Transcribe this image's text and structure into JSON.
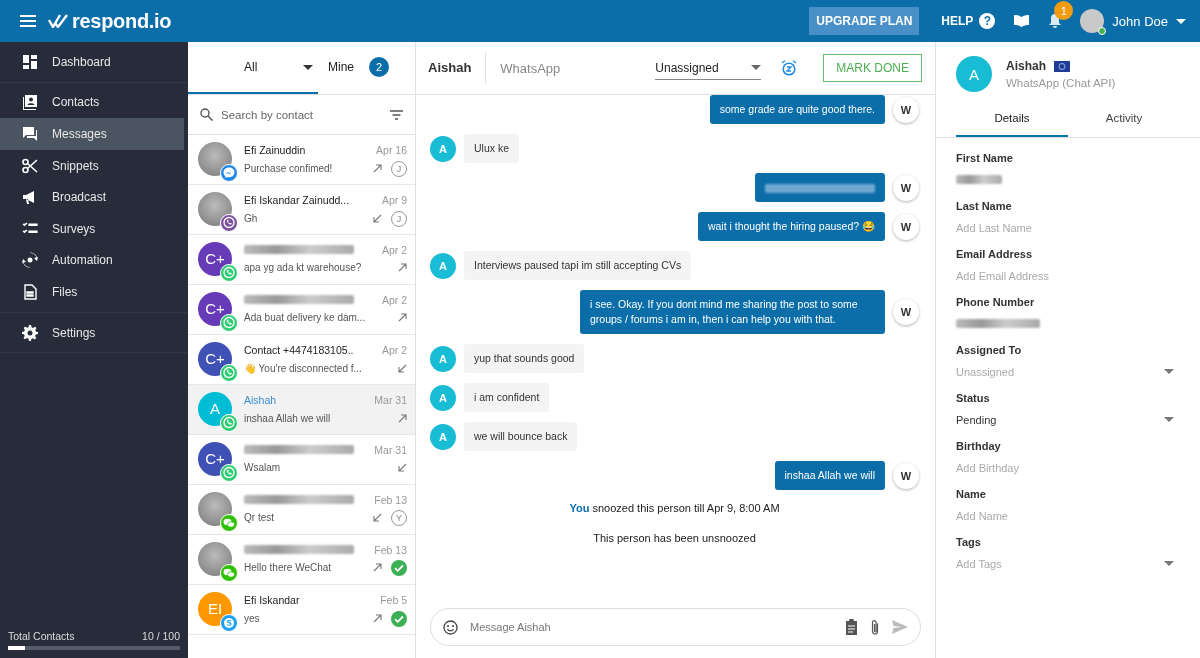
{
  "topbar": {
    "brand": "respond.io",
    "upgrade": "UPGRADE PLAN",
    "help": "HELP",
    "help_mark": "?",
    "notifications": "1",
    "user": "John Doe"
  },
  "sidebar": {
    "groups": [
      [
        {
          "label": "Dashboard",
          "selected": false
        }
      ],
      [
        {
          "label": "Contacts",
          "selected": false
        },
        {
          "label": "Messages",
          "selected": true
        },
        {
          "label": "Snippets",
          "selected": false
        },
        {
          "label": "Broadcast",
          "selected": false
        },
        {
          "label": "Surveys",
          "selected": false
        },
        {
          "label": "Automation",
          "selected": false
        },
        {
          "label": "Files",
          "selected": false
        }
      ],
      [
        {
          "label": "Settings",
          "selected": false
        }
      ]
    ],
    "footer": {
      "label": "Total Contacts",
      "count": "10 / 100",
      "level": 0.1
    }
  },
  "inbox": {
    "tabs": [
      {
        "label": "All",
        "selected": true,
        "dropdown": true
      },
      {
        "label": "Mine",
        "selected": false,
        "count": "2"
      }
    ],
    "search": {
      "placeholder": "Search by contact"
    },
    "conversations": [
      {
        "kind": "messenger",
        "name": "Efi Zainuddin",
        "preview": "Purchase confimed!",
        "date": "Apr 16",
        "outgoing": true,
        "assignee": "J",
        "done": false,
        "avatar": {
          "kind": "photo"
        },
        "selected": false
      },
      {
        "kind": "viber",
        "name": "Efi Iskandar Zainudd...",
        "preview": "Gh",
        "date": "Apr 9",
        "outgoing": false,
        "assignee": "J",
        "done": false,
        "avatar": {
          "kind": "photo"
        },
        "selected": false
      },
      {
        "kind": "whatsapp",
        "redacted": true,
        "preview": "apa yg ada kt warehouse?",
        "date": "Apr 2",
        "outgoing": true,
        "done": false,
        "avatar": {
          "kind": "initials",
          "text": "C+",
          "color": "#673ab7"
        },
        "selected": false
      },
      {
        "kind": "whatsapp",
        "redacted": true,
        "preview": "Ada buat delivery ke dam...",
        "date": "Apr 2",
        "outgoing": true,
        "done": false,
        "avatar": {
          "kind": "initials",
          "text": "C+",
          "color": "#673ab7"
        },
        "selected": false
      },
      {
        "kind": "whatsapp",
        "name": "Contact +4474183105..",
        "preview": "👋 You're disconnected f...",
        "date": "Apr 2",
        "outgoing": false,
        "done": false,
        "avatar": {
          "kind": "initials",
          "text": "C+",
          "color": "#3f51b5"
        },
        "selected": false
      },
      {
        "kind": "whatsapp",
        "name": "Aishah",
        "preview": "inshaa Allah we will",
        "date": "Mar 31",
        "outgoing": true,
        "done": false,
        "avatar": {
          "kind": "initials",
          "text": "A",
          "color": "#00bcd4"
        },
        "selected": true
      },
      {
        "kind": "whatsapp",
        "redacted": true,
        "preview": "Wsalam",
        "date": "Mar 31",
        "outgoing": false,
        "done": false,
        "avatar": {
          "kind": "initials",
          "text": "C+",
          "color": "#3f51b5"
        },
        "selected": false
      },
      {
        "kind": "wechat",
        "redacted": true,
        "preview": "Qr test",
        "date": "Feb 13",
        "outgoing": false,
        "assignee": "Y",
        "done": false,
        "avatar": {
          "kind": "photo"
        },
        "selected": false
      },
      {
        "kind": "wechat",
        "redacted": true,
        "preview": "Hello there WeChat",
        "date": "Feb 13",
        "outgoing": true,
        "done": true,
        "avatar": {
          "kind": "photo"
        },
        "selected": false
      },
      {
        "kind": "skype",
        "name": "Efi Iskandar",
        "preview": "yes",
        "date": "Feb 5",
        "outgoing": true,
        "done": true,
        "avatar": {
          "kind": "initials",
          "text": "EI",
          "color": "#ff9800"
        },
        "selected": false
      }
    ]
  },
  "chat": {
    "contact": {
      "name": "Aishah"
    },
    "channel": "WhatsApp",
    "assignee": "Unassigned",
    "action": "MARK DONE",
    "messages": [
      {
        "kind": "out",
        "text": "some grade are quite good there.",
        "author": "W"
      },
      {
        "kind": "in",
        "text": "Ulux ke",
        "author": "A"
      },
      {
        "kind": "out",
        "redacted": true,
        "author": "W"
      },
      {
        "kind": "out",
        "text": "wait i thought the hiring paused? 😂",
        "author": "W"
      },
      {
        "kind": "in",
        "text": "Interviews paused tapi im still accepting CVs",
        "author": "A"
      },
      {
        "kind": "out",
        "text": "i see. Okay. If you dont mind me sharing the post to some groups / forums i am in, then i can help you with that.",
        "author": "W"
      },
      {
        "kind": "in",
        "text": "yup that sounds good",
        "author": "A"
      },
      {
        "kind": "in",
        "text": "i am confident",
        "author": "A"
      },
      {
        "kind": "in",
        "text": "we will bounce back",
        "author": "A"
      },
      {
        "kind": "out",
        "text": "inshaa Allah we will",
        "author": "W"
      },
      {
        "kind": "event",
        "actor": "You",
        "text": "snoozed this person till Apr 9, 8:00 AM"
      },
      {
        "kind": "event",
        "text": "This person has been unsnoozed"
      }
    ],
    "composer": {
      "placeholder": "Message Aishah"
    }
  },
  "contact": {
    "initial": "A",
    "name": "Aishah",
    "channel": "WhatsApp (Chat API)",
    "tabs": [
      {
        "label": "Details",
        "selected": true
      },
      {
        "label": "Activity",
        "selected": false
      }
    ],
    "fields": [
      {
        "label": "First Name",
        "kind": "text",
        "redacted": true
      },
      {
        "label": "Last Name",
        "kind": "text",
        "placeholder": "Add Last Name"
      },
      {
        "label": "Email Address",
        "kind": "text",
        "placeholder": "Add Email Address"
      },
      {
        "label": "Phone Number",
        "kind": "text",
        "redacted": true
      },
      {
        "label": "Assigned To",
        "kind": "select",
        "placeholder": "Unassigned"
      },
      {
        "label": "Status",
        "kind": "select",
        "value": "Pending"
      },
      {
        "label": "Birthday",
        "kind": "text",
        "placeholder": "Add Birthday"
      },
      {
        "label": "Name",
        "kind": "text",
        "placeholder": "Add Name"
      },
      {
        "label": "Tags",
        "kind": "select",
        "placeholder": "Add Tags"
      }
    ]
  }
}
